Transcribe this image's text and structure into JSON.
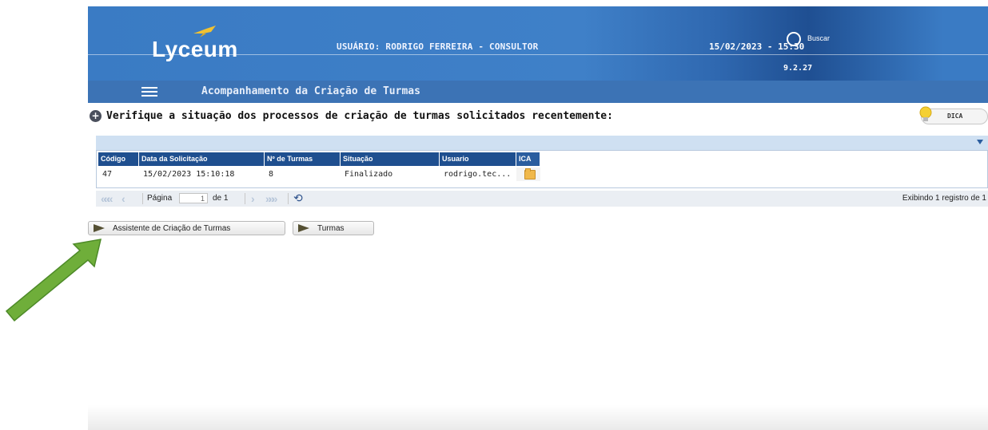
{
  "header": {
    "logo": "Lyceum",
    "user": "USUÁRIO: RODRIGO FERREIRA - CONSULTOR",
    "datetime": "15/02/2023 - 15:30",
    "version": "9.2.27",
    "search_label": "Buscar"
  },
  "subbar": {
    "title": "Acompanhamento da Criação de Turmas"
  },
  "info": {
    "text": "Verifique a situação dos processos de criação de turmas solicitados recentemente:",
    "dica_label": "DICA"
  },
  "grid": {
    "columns": [
      "Código",
      "Data da Solicitação",
      "Nº de Turmas",
      "Situação",
      "Usuario",
      "ICA"
    ],
    "rows": [
      {
        "codigo": "47",
        "data": "15/02/2023 15:10:18",
        "turmas": "8",
        "situacao": "Finalizado",
        "usuario": "rodrigo.tec..."
      }
    ]
  },
  "pager": {
    "page_label": "Página",
    "page_value": "1",
    "of_label": "de 1",
    "status": "Exibindo 1 registro de 1"
  },
  "buttons": {
    "assistente": "Assistente de Criação de Turmas",
    "turmas": "Turmas"
  },
  "colors": {
    "header_blue": "#3a7bc4",
    "subbar_blue": "#3c73b5",
    "grid_header": "#1f4f8f",
    "annotation_arrow": "#6fae3a"
  }
}
